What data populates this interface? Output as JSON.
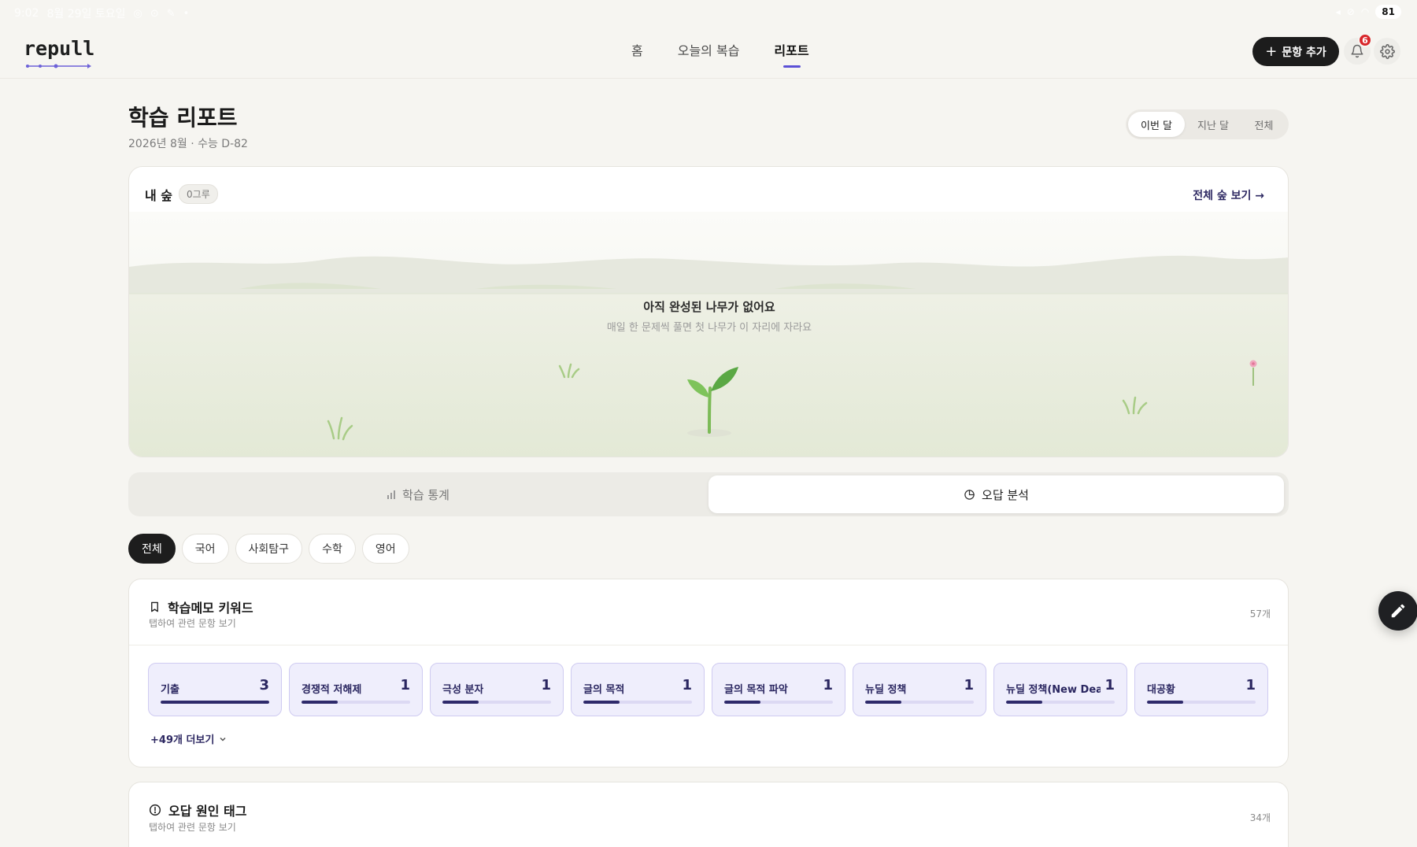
{
  "status_bar": {
    "time": "9:02",
    "date": "8월 29일 토요일",
    "battery": "81"
  },
  "header": {
    "logo": "repull",
    "nav": [
      {
        "label": "홈"
      },
      {
        "label": "오늘의 복습"
      },
      {
        "label": "리포트",
        "active": true
      }
    ],
    "add_button": "문항 추가",
    "notification_count": "6"
  },
  "page": {
    "title": "학습 리포트",
    "subtitle": "2026년 8월 · 수능 D-82",
    "period_options": [
      "이번 달",
      "지난 달",
      "전체"
    ],
    "period_selected": "이번 달"
  },
  "forest": {
    "title": "내 숲",
    "count": "0그루",
    "link": "전체 숲 보기 →",
    "empty_title": "아직 완성된 나무가 없어요",
    "empty_sub": "매일 한 문제씩 풀면 첫 나무가 이 자리에 자라요"
  },
  "tabs": [
    {
      "label": "학습 통계",
      "icon": "bar-chart-icon"
    },
    {
      "label": "오답 분석",
      "icon": "pie-chart-icon",
      "active": true
    }
  ],
  "filters": [
    {
      "label": "전체",
      "active": true
    },
    {
      "label": "국어"
    },
    {
      "label": "사회탐구"
    },
    {
      "label": "수학"
    },
    {
      "label": "영어"
    }
  ],
  "keywords": {
    "title": "학습메모 키워드",
    "subtitle": "탭하여 관련 문항 보기",
    "total": "57개",
    "items": [
      {
        "label": "기출",
        "count": "3",
        "fill": 1.0
      },
      {
        "label": "경쟁적 저해제",
        "count": "1",
        "fill": 0.333
      },
      {
        "label": "극성 분자",
        "count": "1",
        "fill": 0.333
      },
      {
        "label": "글의 목적",
        "count": "1",
        "fill": 0.333
      },
      {
        "label": "글의 목적 파악",
        "count": "1",
        "fill": 0.333
      },
      {
        "label": "뉴딜 정책",
        "count": "1",
        "fill": 0.333
      },
      {
        "label": "뉴딜 정책(New Dea..",
        "count": "1",
        "fill": 0.333
      },
      {
        "label": "대공황",
        "count": "1",
        "fill": 0.333
      }
    ],
    "more": "+49개 더보기"
  },
  "error_tags": {
    "title": "오답 원인 태그",
    "subtitle": "탭하여 관련 문항 보기",
    "total": "34개"
  },
  "colors": {
    "accent": "#5b50d6",
    "keyword_tile_bg": "#efeefc",
    "keyword_fill": "#2e2a6b",
    "dark_button": "#1c1c1c",
    "badge": "#d8262a"
  }
}
